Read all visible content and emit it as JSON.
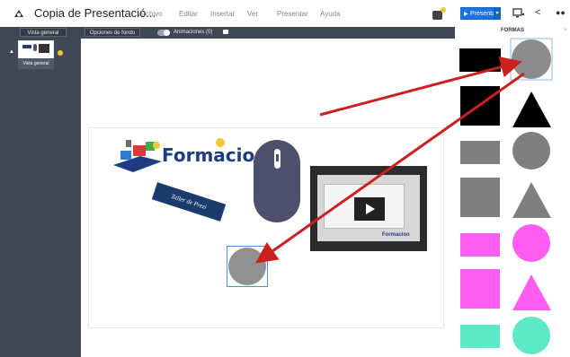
{
  "header": {
    "title": "Copia de Presentació...",
    "menu": [
      "Archivo",
      "Editar",
      "Insertar",
      "Ver",
      "Presentar",
      "Ayuda"
    ],
    "present_label": "Presentar"
  },
  "toolbar": {
    "overview_label": "Vista general",
    "settings_label": "Opciones de fondo",
    "animations_label": "Animaciones (0)"
  },
  "sidebar": {
    "thumbnail_label": "Vista general"
  },
  "canvas": {
    "logo_text": "Formacion",
    "badge_text": "Taller de Prezi",
    "video_watermark": "Formacion"
  },
  "shapes_panel": {
    "title": "FORMAS",
    "colors": {
      "black": "#000000",
      "gray": "#7f7f7f",
      "pink": "#ff5cf0",
      "teal": "#5de8c6"
    }
  },
  "colors": {
    "sidebar_bg": "#3f4854",
    "accent_blue": "#1a73e8",
    "arrow_red": "#cc1f1f"
  }
}
